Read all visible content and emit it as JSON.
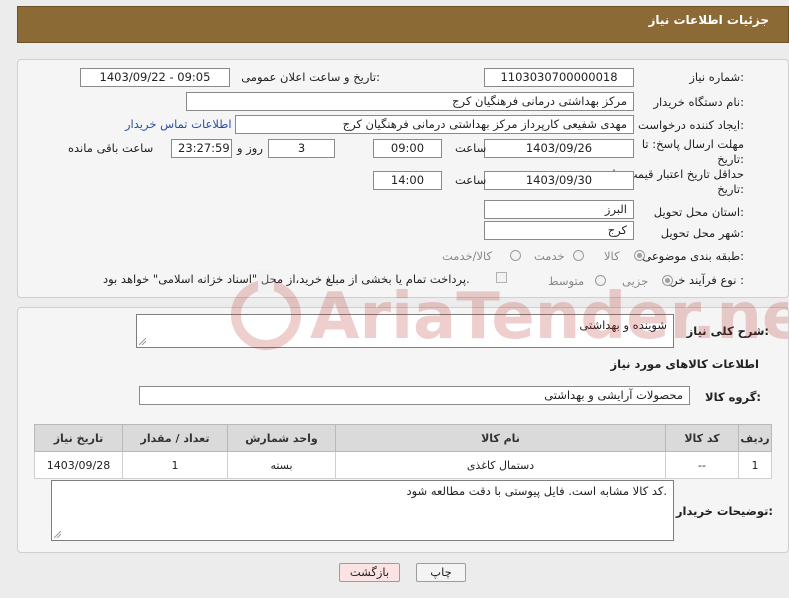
{
  "header": {
    "title": "جزئیات اطلاعات نیاز"
  },
  "form": {
    "need_number": {
      "label": "شماره نیاز:",
      "value": "1103030700000018"
    },
    "announce_datetime": {
      "label": "تاریخ و ساعت اعلان عمومی:",
      "value": "1403/09/22 - 09:05"
    },
    "buyer_org": {
      "label": "نام دستگاه خریدار:",
      "value": "مرکز بهداشتی درمانی فرهنگیان کرج"
    },
    "requester": {
      "label": "ایجاد کننده درخواست:",
      "value": "مهدی شفیعی کارپرداز مرکز بهداشتی درمانی فرهنگیان کرج",
      "contact_link": "اطلاعات تماس خریدار"
    },
    "reply_deadline": {
      "label_line1": "مهلت ارسال پاسخ: تا",
      "label_line2": "تاریخ:",
      "date": "1403/09/26",
      "time_label": "ساعت",
      "time": "09:00",
      "days": "3",
      "days_label": "روز و",
      "remaining": "23:27:59",
      "remaining_label": "ساعت باقی مانده"
    },
    "price_validity": {
      "label_line1": "حداقل تاریخ اعتبار قیمت: تا",
      "label_line2": "تاریخ:",
      "date": "1403/09/30",
      "time_label": "ساعت",
      "time": "14:00"
    },
    "delivery_province": {
      "label": "استان محل تحویل:",
      "value": "البرز"
    },
    "delivery_city": {
      "label": "شهر محل تحویل:",
      "value": "کرج"
    },
    "category": {
      "label": "طبقه بندی موضوعی:",
      "options": [
        "کالا",
        "خدمت",
        "کالا/خدمت"
      ],
      "selected": "کالا"
    },
    "purchase_process": {
      "label": "نوع فرآیند خرید :",
      "options": [
        "جزیی",
        "متوسط"
      ],
      "selected": "جزیی",
      "payment_note": "پرداخت تمام یا بخشی از مبلغ خرید،از محل \"اسناد خزانه اسلامی\" خواهد بود."
    }
  },
  "details": {
    "general_desc_label": "شرح کلی نیاز:",
    "general_desc": "شوینده و بهداشتی",
    "items_section_title": "اطلاعات کالاهای مورد نیاز",
    "goods_group_label": "گروه کالا:",
    "goods_group": "محصولات آرایشی و بهداشتی",
    "table": {
      "headers": [
        "ردیف",
        "کد کالا",
        "نام کالا",
        "واحد شمارش",
        "تعداد / مقدار",
        "تاریخ نیاز"
      ],
      "rows": [
        [
          "1",
          "--",
          "دستمال کاغذی",
          "بسته",
          "1",
          "1403/09/28"
        ]
      ]
    },
    "buyer_notes_label": "توضیحات خریدار:",
    "buyer_notes": "کد کالا مشابه است. فایل پیوستی با دقت مطالعه شود."
  },
  "buttons": {
    "print": "چاپ",
    "back": "بازگشت"
  },
  "watermark": "AriaTender.neT",
  "colors": {
    "header_bg": "#8c6a36",
    "back_button_bg": "#fbe3e3",
    "link": "#2a4ea8"
  }
}
